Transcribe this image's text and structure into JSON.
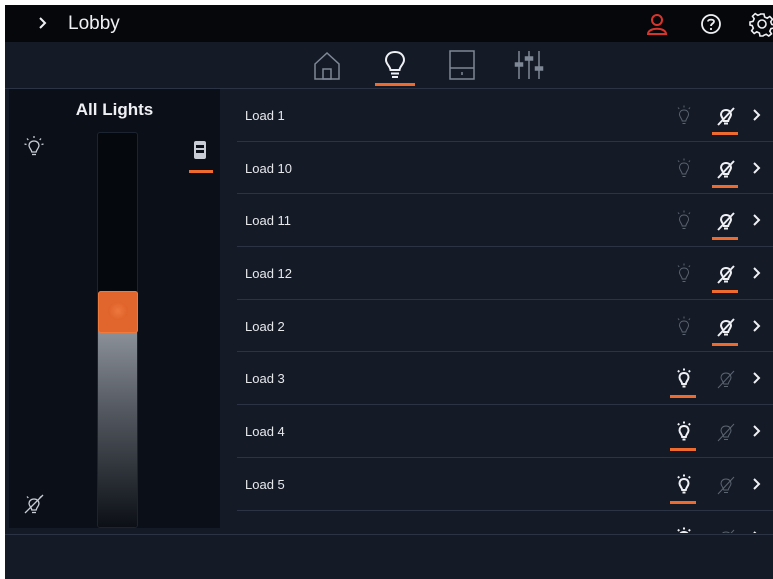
{
  "header": {
    "title": "Lobby",
    "icons": [
      "chevron-right-icon",
      "user-icon",
      "help-icon",
      "gear-icon"
    ],
    "user_icon_color": "#d9342b"
  },
  "tabs": [
    {
      "name": "home",
      "icon": "home-icon",
      "active": false
    },
    {
      "name": "lights",
      "icon": "bulb-icon",
      "active": true
    },
    {
      "name": "shades",
      "icon": "shade-icon",
      "active": false
    },
    {
      "name": "controls",
      "icon": "sliders-icon",
      "active": false
    }
  ],
  "panel": {
    "title": "All Lights",
    "level_fraction": 0.55,
    "keypad_selected": true
  },
  "loads": [
    {
      "name": "Load 1",
      "state": "off"
    },
    {
      "name": "Load 10",
      "state": "off"
    },
    {
      "name": "Load 11",
      "state": "off"
    },
    {
      "name": "Load 12",
      "state": "off"
    },
    {
      "name": "Load 2",
      "state": "off"
    },
    {
      "name": "Load 3",
      "state": "on"
    },
    {
      "name": "Load 4",
      "state": "on"
    },
    {
      "name": "Load 5",
      "state": "on"
    },
    {
      "name": "",
      "state": "on"
    }
  ],
  "colors": {
    "accent": "#ee6a2e",
    "background": "#141a26",
    "header": "#05070b"
  }
}
